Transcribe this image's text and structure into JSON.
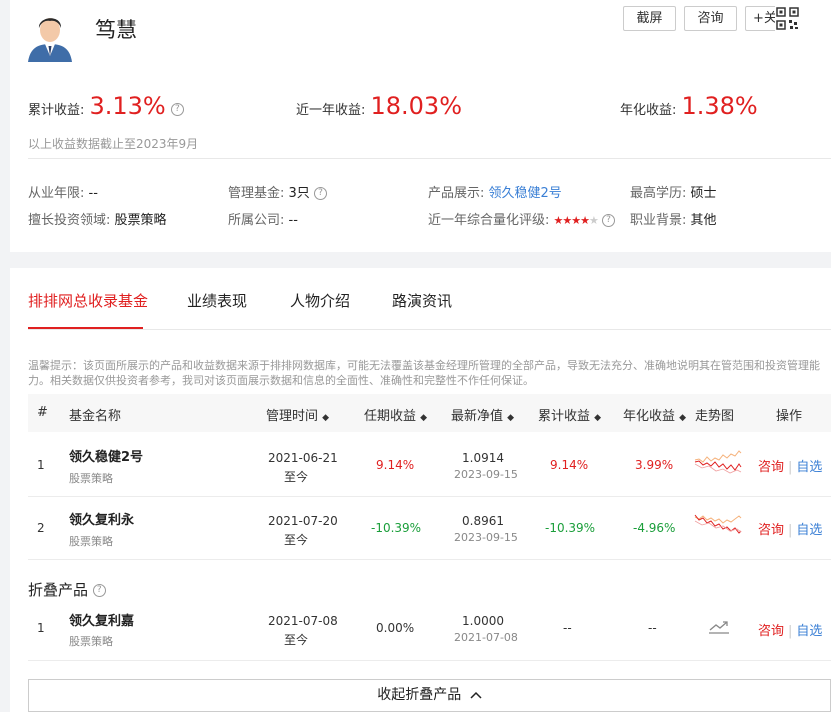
{
  "manager": {
    "name": "笃慧"
  },
  "header_buttons": {
    "screenshot": "截屏",
    "consult": "咨询",
    "follow": "+关注"
  },
  "metrics": {
    "cumulative_label": "累计收益:",
    "cumulative_value": "3.13%",
    "year_label": "近一年收益:",
    "year_value": "18.03%",
    "annual_label": "年化收益:",
    "annual_value": "1.38%"
  },
  "data_note": "以上收益数据截止至2023年9月",
  "info": {
    "years_label": "从业年限:",
    "years_value": "--",
    "funds_label": "管理基金:",
    "funds_value": "3只",
    "product_label": "产品展示:",
    "product_value": "领久稳健2号",
    "education_label": "最高学历:",
    "education_value": "硕士",
    "field_label": "擅长投资领域:",
    "field_value": "股票策略",
    "company_label": "所属公司:",
    "company_value": "--",
    "rating_label": "近一年综合量化评级:",
    "rating_stars": 4,
    "background_label": "职业背景:",
    "background_value": "其他"
  },
  "tabs": [
    "排排网总收录基金",
    "业绩表现",
    "人物介绍",
    "路演资讯"
  ],
  "tip_text": "温馨提示：该页面所展示的产品和收益数据来源于排排网数据库，可能无法覆盖该基金经理所管理的全部产品，导致无法充分、准确地说明其在管范围和投资管理能力。相关数据仅供投资者参考，我司对该页面展示数据和信息的全面性、准确性和完整性不作任何保证。",
  "table": {
    "headers": {
      "idx": "#",
      "name": "基金名称",
      "period": "管理时间",
      "tenure": "任期收益",
      "nav": "最新净值",
      "cum": "累计收益",
      "annual": "年化收益",
      "trend": "走势图",
      "ops": "操作"
    },
    "sort_glyph": "◆",
    "rows": [
      {
        "idx": "1",
        "name": "领久稳健2号",
        "type": "股票策略",
        "start": "2021-06-21",
        "end": "至今",
        "tenure": "9.14%",
        "nav": "1.0914",
        "nav_date": "2023-09-15",
        "cum": "9.14%",
        "annual": "3.99%",
        "consult": "咨询",
        "watch": "自选",
        "sep": "|"
      },
      {
        "idx": "2",
        "name": "领久复利永",
        "type": "股票策略",
        "start": "2021-07-20",
        "end": "至今",
        "tenure": "-10.39%",
        "nav": "0.8961",
        "nav_date": "2023-09-15",
        "cum": "-10.39%",
        "annual": "-4.96%",
        "consult": "咨询",
        "watch": "自选",
        "sep": "|"
      }
    ]
  },
  "folded": {
    "title": "折叠产品",
    "rows": [
      {
        "idx": "1",
        "name": "领久复利嘉",
        "type": "股票策略",
        "start": "2021-07-08",
        "end": "至今",
        "tenure": "0.00%",
        "nav": "1.0000",
        "nav_date": "2021-07-08",
        "cum": "--",
        "annual": "--",
        "consult": "咨询",
        "watch": "自选",
        "sep": "|"
      }
    ]
  },
  "collapse_label": "收起折叠产品",
  "colors": {
    "accent": "#e02020",
    "positive": "#e02020",
    "negative": "#1a9e3a",
    "link": "#3a7fd5"
  }
}
